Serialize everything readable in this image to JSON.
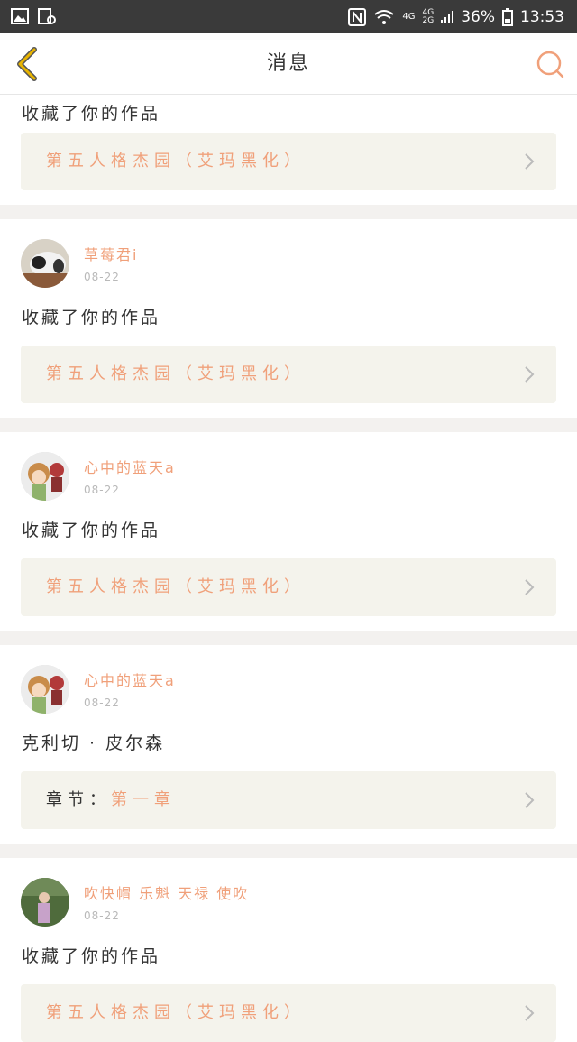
{
  "status_bar": {
    "network1": "4G",
    "network2": "4G\n2G",
    "battery": "36%",
    "time": "13:53"
  },
  "header": {
    "title": "消息"
  },
  "feed": [
    {
      "action": "收藏了你的作品",
      "link": "第五人格杰园（艾玛黑化）"
    },
    {
      "user": "草莓君i",
      "date": "08-22",
      "action": "收藏了你的作品",
      "link": "第五人格杰园（艾玛黑化）"
    },
    {
      "user": "心中的蓝天a",
      "date": "08-22",
      "action": "收藏了你的作品",
      "link": "第五人格杰园（艾玛黑化）"
    },
    {
      "user": "心中的蓝天a",
      "date": "08-22",
      "action": "克利切 · 皮尔森",
      "link_prefix": "章节：",
      "link": "第一章"
    },
    {
      "user": "吹快帽 乐魁 天禄 使吹",
      "date": "08-22",
      "action": "收藏了你的作品",
      "link": "第五人格杰园（艾玛黑化）"
    }
  ],
  "colors": {
    "accent": "#f0a07a",
    "back_icon": "#e8b400",
    "link_bg": "#f4f3ec"
  }
}
